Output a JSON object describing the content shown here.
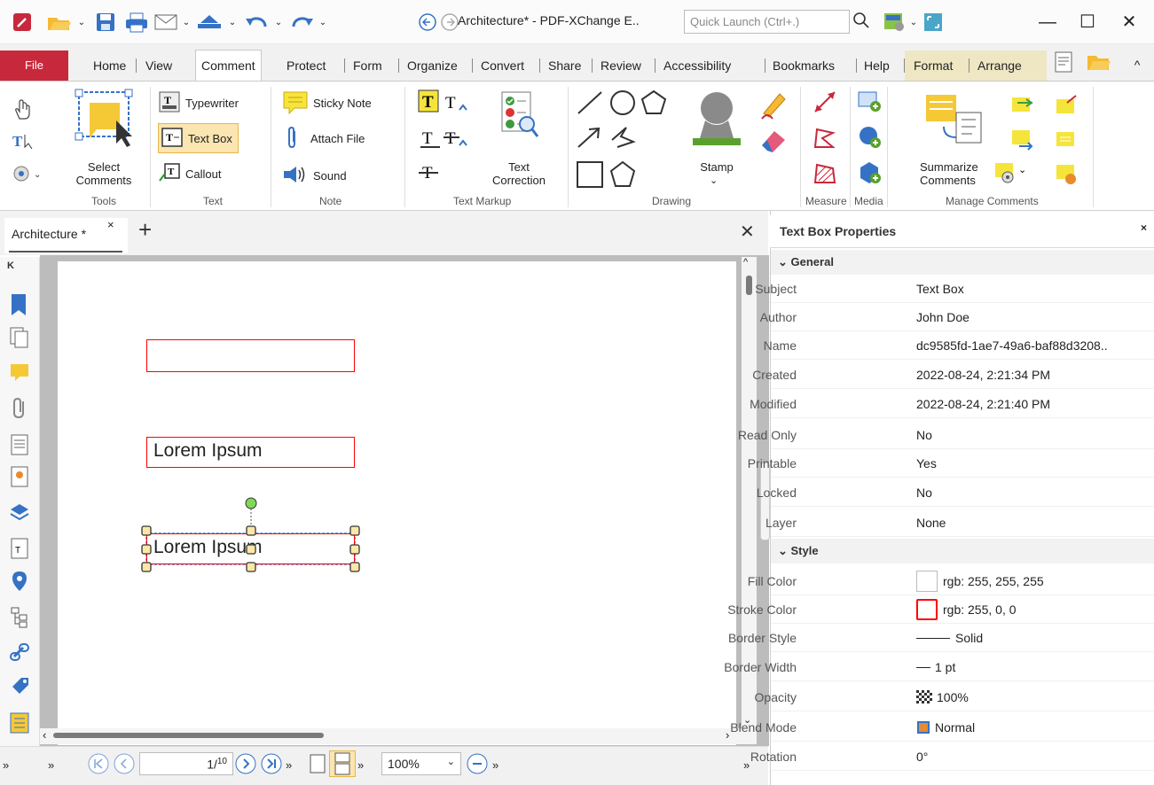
{
  "window": {
    "title": "Architecture* - PDF-XChange E..",
    "quick_launch_placeholder": "Quick Launch (Ctrl+.)",
    "minimize_glyph": "—",
    "maximize_glyph": "☐",
    "close_glyph": "✕"
  },
  "menu": {
    "file": "File",
    "tabs": [
      "Home",
      "View",
      "Comment",
      "Protect",
      "Form",
      "Organize",
      "Convert",
      "Share",
      "Review",
      "Accessibility",
      "Bookmarks",
      "Help",
      "Format",
      "Arrange"
    ],
    "active": "Comment"
  },
  "ribbon": {
    "tools": {
      "select_comments": "Select\nComments",
      "group": "Tools"
    },
    "text": {
      "typewriter": "Typewriter",
      "text_box": "Text Box",
      "callout": "Callout",
      "group": "Text"
    },
    "note": {
      "sticky_note": "Sticky Note",
      "attach_file": "Attach File",
      "sound": "Sound",
      "group": "Note"
    },
    "markup": {
      "text_correction": "Text\nCorrection",
      "group": "Text Markup"
    },
    "drawing": {
      "stamp": "Stamp",
      "group": "Drawing"
    },
    "measure": {
      "group": "Measure"
    },
    "media": {
      "group": "Media"
    },
    "manage": {
      "summarize": "Summarize\nComments",
      "group": "Manage Comments"
    }
  },
  "document": {
    "tab": "Architecture *",
    "box2_text": "Lorem Ipsum",
    "box3_text": "Lorem Ipsum"
  },
  "statusbar": {
    "page_current": "1",
    "page_total": "10",
    "zoom": "100%"
  },
  "properties": {
    "title": "Text Box Properties",
    "general_header": "General",
    "general": [
      {
        "key": "Subject",
        "value": "Text Box"
      },
      {
        "key": "Author",
        "value": "John Doe"
      },
      {
        "key": "Name",
        "value": "dc9585fd-1ae7-49a6-baf88d3208.."
      },
      {
        "key": "Created",
        "value": "2022-08-24, 2:21:34 PM"
      },
      {
        "key": "Modified",
        "value": "2022-08-24, 2:21:40 PM"
      },
      {
        "key": "Read Only",
        "value": "No"
      },
      {
        "key": "Printable",
        "value": "Yes"
      },
      {
        "key": "Locked",
        "value": "No"
      },
      {
        "key": "Layer",
        "value": "None"
      }
    ],
    "style_header": "Style",
    "style": [
      {
        "key": "Fill Color",
        "value": "rgb: 255, 255, 255"
      },
      {
        "key": "Stroke Color",
        "value": "rgb: 255, 0, 0"
      },
      {
        "key": "Border Style",
        "value": "Solid"
      },
      {
        "key": "Border Width",
        "value": "1 pt"
      },
      {
        "key": "Opacity",
        "value": "100%"
      },
      {
        "key": "Blend Mode",
        "value": "Normal"
      },
      {
        "key": "Rotation",
        "value": "0°"
      }
    ]
  },
  "colors": {
    "file_tab": "#c8283b",
    "stroke": "#ff0000",
    "selection_highlight": "#fbe5b0"
  }
}
